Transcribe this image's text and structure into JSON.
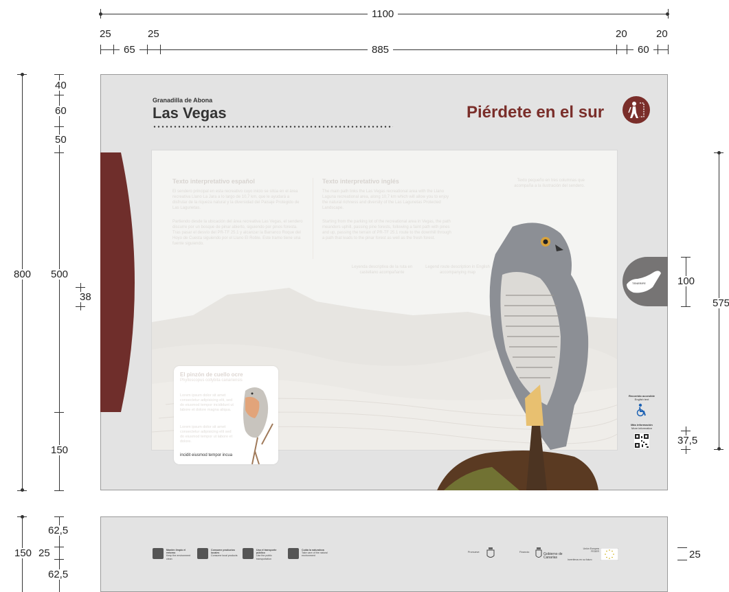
{
  "dimensions": {
    "top_total": "1100",
    "top_parts": [
      "25",
      "65",
      "25",
      "885",
      "20",
      "60",
      "20"
    ],
    "left_outer": "800",
    "left_inner": [
      "40",
      "60",
      "50",
      "500",
      "150"
    ],
    "left_small": "38",
    "right_outer": "575",
    "right_tab": "100",
    "right_small": "37,5",
    "bottom_outer": "150",
    "bottom_parts": [
      "62,5",
      "25",
      "62,5"
    ],
    "bottom_left_small": "25",
    "bottom_right": "25"
  },
  "panel": {
    "subtitle": "Granadilla de Abona",
    "title": "Las Vegas",
    "slogan": "Piérdete en el sur",
    "col1_head": "Texto interpretativo español",
    "col1_text": "El sendero principal en esta recreativo cuyo inicio se sitúa en el área recreativa Llano La Jara a lo largo de 10,7 km, que le ayudará a disfrutar de la riqueza natural y la diversidad del Paisaje Protegido de Las Lagunetas.",
    "col1_text2": "Partiendo desde la ubicación del área recreativa Las Vegas, el sendero discurre por un bosque de pinar abierto, siguiendo por pinos foresta. Tras pasar el desvío del PR-TF 25.1 y alcanzar la Barranco Roque del Hoyo de Cuesta siguiendo por el Llano El Roble. Este tramo tiene una fuente siguiendo.",
    "col2_head": "Texto interpretativo inglés",
    "col2_text": "The main path links the Las Vegas recreational area with the Llano Laguna recreational area, along 10,7 km which will allow you to enjoy the natural richness and diversity of the Las Lagunetas Protected Landscape.",
    "col2_text2": "Starting from the parking lot of the recreational area in Vegas, the path meanders uphill, passing pine forests, following a faint path with pines and up, passing the terrain of PR-TF 25.1 route to the downhill through a path that leads to the pinar forest as well as the fresh forest.",
    "col3_text": "Texto pequeño en tres columnas que acompaña a la ilustración del sendero.",
    "mid_left": "Leyenda descriptiva de la ruta en castellano acompañante",
    "mid_right": "Legend route description in English accompanying map",
    "bird_head": "El pinzón de cuello ocre",
    "bird_sub": "Phylloscopus collybita canariensis",
    "bird_text1": "Lorem ipsum dolor sit amet consectetur adipisicing elit, sed do eiusmod tempor incididunt ut labore et dolore magna aliqua.",
    "bird_text2": "Lorem ipsum dolor sit amet consectetur adipisicing elit sed do eiusmod tempor ut labore et dolore.",
    "bird_last": "incidit eiusmod tempor incua",
    "tab_label": "TENERIFE",
    "acc1": "Recorrido accesible",
    "acc1_sub": "English text",
    "acc2": "Más información",
    "acc2_sub": "More information"
  },
  "footer": {
    "items": [
      {
        "label": "Mantén limpio el entorno",
        "sub": "Keep the environment clean"
      },
      {
        "label": "Consume productos locales",
        "sub": "Consume local products"
      },
      {
        "label": "Usa el transporte público",
        "sub": "Use the public transportation"
      },
      {
        "label": "Cuida la naturaleza",
        "sub": "Take care of the natural environment"
      }
    ],
    "promotes": "Promueve:",
    "finances": "Financia:",
    "gov": "Gobierno de Canarias",
    "eu_top": "Unión Europea",
    "eu_fund": "FEDER",
    "eu_motto": "Invertimos en su futuro"
  },
  "colors": {
    "brand": "#7a2e2a",
    "panel_bg": "#e3e3e3",
    "tab": "#767474",
    "access": "#1f63b4"
  }
}
